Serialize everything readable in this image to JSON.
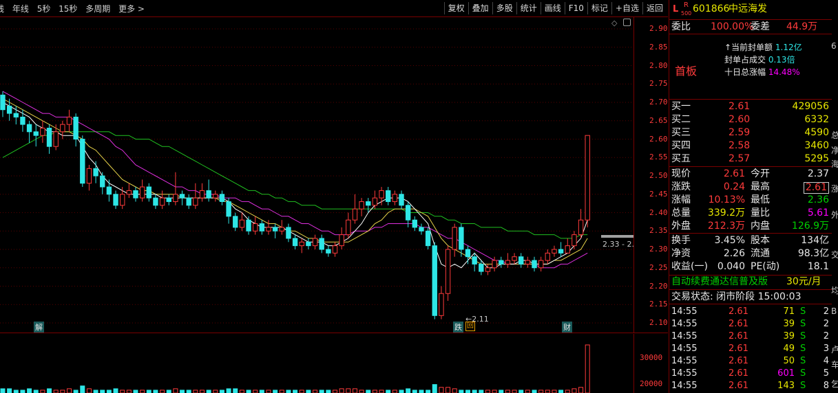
{
  "toolbar": {
    "left_items": [
      "线",
      "年线",
      "5秒",
      "15秒",
      "多周期",
      "更多 >"
    ],
    "right_items": [
      "复权",
      "叠加",
      "多股",
      "统计",
      "画线",
      "F10",
      "标记",
      "+自选",
      "返回"
    ]
  },
  "chart": {
    "price_ticks": [
      "2.90",
      "2.85",
      "2.80",
      "2.75",
      "2.70",
      "2.65",
      "2.60",
      "2.55",
      "2.50",
      "2.45",
      "2.40",
      "2.35",
      "2.30",
      "2.25",
      "2.20",
      "2.15",
      "2.10"
    ],
    "volume_ticks": [
      "30000",
      "20000"
    ],
    "annotations": {
      "low_price": "2.11",
      "last_price_marker": "2.33 - 2.",
      "event_jie": "解",
      "event_die": "跌",
      "event_hui": "回",
      "event_cai": "财"
    },
    "colors": {
      "up": "#ff3b3b",
      "down": "#2ee6e6",
      "ma5": "#ffffff",
      "ma10": "#e8d34a",
      "ma20": "#e030e0",
      "ma60": "#20c020"
    },
    "chart_data": {
      "type": "candlestick",
      "ylim": [
        2.08,
        2.92
      ],
      "candles": [
        [
          2.72,
          2.68,
          2.73,
          2.66
        ],
        [
          2.69,
          2.67,
          2.71,
          2.65
        ],
        [
          2.67,
          2.66,
          2.69,
          2.64
        ],
        [
          2.66,
          2.64,
          2.68,
          2.62
        ],
        [
          2.64,
          2.62,
          2.65,
          2.59
        ],
        [
          2.62,
          2.61,
          2.64,
          2.58
        ],
        [
          2.61,
          2.63,
          2.65,
          2.59
        ],
        [
          2.63,
          2.58,
          2.64,
          2.56
        ],
        [
          2.58,
          2.62,
          2.64,
          2.57
        ],
        [
          2.62,
          2.64,
          2.65,
          2.6
        ],
        [
          2.64,
          2.66,
          2.68,
          2.62
        ],
        [
          2.66,
          2.6,
          2.67,
          2.58
        ],
        [
          2.6,
          2.48,
          2.61,
          2.47
        ],
        [
          2.48,
          2.52,
          2.53,
          2.46
        ],
        [
          2.52,
          2.5,
          2.54,
          2.48
        ],
        [
          2.5,
          2.47,
          2.51,
          2.45
        ],
        [
          2.47,
          2.45,
          2.49,
          2.43
        ],
        [
          2.45,
          2.42,
          2.46,
          2.41
        ],
        [
          2.42,
          2.45,
          2.47,
          2.41
        ],
        [
          2.45,
          2.46,
          2.48,
          2.44
        ],
        [
          2.46,
          2.44,
          2.47,
          2.43
        ],
        [
          2.44,
          2.47,
          2.49,
          2.43
        ],
        [
          2.47,
          2.44,
          2.48,
          2.43
        ],
        [
          2.44,
          2.42,
          2.45,
          2.41
        ],
        [
          2.42,
          2.44,
          2.46,
          2.41
        ],
        [
          2.44,
          2.43,
          2.45,
          2.42
        ],
        [
          2.43,
          2.45,
          2.51,
          2.42
        ],
        [
          2.45,
          2.44,
          2.46,
          2.42
        ],
        [
          2.44,
          2.42,
          2.45,
          2.41
        ],
        [
          2.42,
          2.44,
          2.48,
          2.41
        ],
        [
          2.44,
          2.46,
          2.48,
          2.43
        ],
        [
          2.46,
          2.44,
          2.49,
          2.43
        ],
        [
          2.44,
          2.45,
          2.46,
          2.43
        ],
        [
          2.45,
          2.43,
          2.46,
          2.42
        ],
        [
          2.43,
          2.39,
          2.44,
          2.37
        ],
        [
          2.39,
          2.36,
          2.4,
          2.35
        ],
        [
          2.36,
          2.38,
          2.4,
          2.35
        ],
        [
          2.38,
          2.35,
          2.39,
          2.34
        ],
        [
          2.35,
          2.37,
          2.39,
          2.34
        ],
        [
          2.37,
          2.35,
          2.38,
          2.34
        ],
        [
          2.35,
          2.36,
          2.38,
          2.34
        ],
        [
          2.36,
          2.35,
          2.37,
          2.33
        ],
        [
          2.35,
          2.36,
          2.38,
          2.34
        ],
        [
          2.36,
          2.33,
          2.37,
          2.32
        ],
        [
          2.33,
          2.31,
          2.34,
          2.3
        ],
        [
          2.31,
          2.32,
          2.33,
          2.29
        ],
        [
          2.32,
          2.31,
          2.33,
          2.3
        ],
        [
          2.31,
          2.33,
          2.34,
          2.3
        ],
        [
          2.33,
          2.3,
          2.34,
          2.29
        ],
        [
          2.3,
          2.29,
          2.31,
          2.28
        ],
        [
          2.29,
          2.31,
          2.32,
          2.28
        ],
        [
          2.31,
          2.34,
          2.36,
          2.3
        ],
        [
          2.34,
          2.38,
          2.4,
          2.33
        ],
        [
          2.38,
          2.41,
          2.45,
          2.37
        ],
        [
          2.41,
          2.43,
          2.44,
          2.39
        ],
        [
          2.43,
          2.42,
          2.44,
          2.4
        ],
        [
          2.42,
          2.44,
          2.46,
          2.41
        ],
        [
          2.44,
          2.46,
          2.47,
          2.42
        ],
        [
          2.46,
          2.43,
          2.47,
          2.42
        ],
        [
          2.43,
          2.45,
          2.46,
          2.42
        ],
        [
          2.45,
          2.42,
          2.46,
          2.41
        ],
        [
          2.42,
          2.38,
          2.43,
          2.36
        ],
        [
          2.38,
          2.36,
          2.39,
          2.35
        ],
        [
          2.36,
          2.35,
          2.37,
          2.34
        ],
        [
          2.35,
          2.31,
          2.36,
          2.3
        ],
        [
          2.31,
          2.12,
          2.32,
          2.11
        ],
        [
          2.12,
          2.18,
          2.2,
          2.11
        ],
        [
          2.18,
          2.3,
          2.31,
          2.16
        ],
        [
          2.3,
          2.36,
          2.37,
          2.28
        ],
        [
          2.36,
          2.3,
          2.37,
          2.28
        ],
        [
          2.3,
          2.28,
          2.31,
          2.26
        ],
        [
          2.28,
          2.26,
          2.29,
          2.24
        ],
        [
          2.26,
          2.24,
          2.27,
          2.23
        ],
        [
          2.24,
          2.25,
          2.26,
          2.23
        ],
        [
          2.25,
          2.27,
          2.28,
          2.24
        ],
        [
          2.27,
          2.26,
          2.28,
          2.25
        ],
        [
          2.26,
          2.27,
          2.29,
          2.25
        ],
        [
          2.27,
          2.28,
          2.29,
          2.26
        ],
        [
          2.28,
          2.26,
          2.29,
          2.25
        ],
        [
          2.26,
          2.27,
          2.28,
          2.25
        ],
        [
          2.27,
          2.25,
          2.28,
          2.24
        ],
        [
          2.25,
          2.27,
          2.28,
          2.24
        ],
        [
          2.27,
          2.29,
          2.3,
          2.26
        ],
        [
          2.29,
          2.3,
          2.31,
          2.28
        ],
        [
          2.3,
          2.29,
          2.32,
          2.28
        ],
        [
          2.29,
          2.31,
          2.33,
          2.29
        ],
        [
          2.31,
          2.34,
          2.35,
          2.3
        ],
        [
          2.34,
          2.38,
          2.41,
          2.33
        ],
        [
          2.38,
          2.61,
          2.61,
          2.36
        ]
      ],
      "ma5": [
        2.7,
        2.69,
        2.68,
        2.67,
        2.66,
        2.64,
        2.63,
        2.62,
        2.62,
        2.61,
        2.61,
        2.61,
        2.58,
        2.55,
        2.53,
        2.5,
        2.48,
        2.47,
        2.46,
        2.45,
        2.45,
        2.45,
        2.45,
        2.45,
        2.44,
        2.44,
        2.44,
        2.44,
        2.44,
        2.44,
        2.44,
        2.44,
        2.44,
        2.44,
        2.43,
        2.41,
        2.4,
        2.38,
        2.37,
        2.36,
        2.36,
        2.36,
        2.36,
        2.35,
        2.34,
        2.33,
        2.32,
        2.32,
        2.32,
        2.31,
        2.31,
        2.32,
        2.33,
        2.35,
        2.37,
        2.4,
        2.42,
        2.43,
        2.44,
        2.44,
        2.44,
        2.43,
        2.41,
        2.39,
        2.37,
        2.31,
        2.26,
        2.25,
        2.26,
        2.25,
        2.27,
        2.29,
        2.27,
        2.25,
        2.25,
        2.26,
        2.26,
        2.26,
        2.27,
        2.27,
        2.26,
        2.26,
        2.26,
        2.27,
        2.28,
        2.29,
        2.31,
        2.33,
        2.38
      ],
      "ma10": [
        2.71,
        2.7,
        2.69,
        2.68,
        2.67,
        2.66,
        2.65,
        2.64,
        2.63,
        2.62,
        2.62,
        2.61,
        2.6,
        2.58,
        2.57,
        2.55,
        2.53,
        2.51,
        2.49,
        2.48,
        2.47,
        2.46,
        2.46,
        2.45,
        2.45,
        2.45,
        2.45,
        2.44,
        2.44,
        2.44,
        2.44,
        2.44,
        2.44,
        2.43,
        2.43,
        2.42,
        2.41,
        2.4,
        2.39,
        2.38,
        2.37,
        2.37,
        2.36,
        2.35,
        2.35,
        2.34,
        2.33,
        2.33,
        2.32,
        2.32,
        2.32,
        2.32,
        2.32,
        2.33,
        2.34,
        2.35,
        2.37,
        2.38,
        2.4,
        2.41,
        2.41,
        2.41,
        2.41,
        2.4,
        2.39,
        2.36,
        2.33,
        2.31,
        2.3,
        2.29,
        2.28,
        2.27,
        2.26,
        2.26,
        2.26,
        2.26,
        2.26,
        2.26,
        2.26,
        2.26,
        2.26,
        2.26,
        2.26,
        2.27,
        2.27,
        2.28,
        2.29,
        2.3,
        2.33
      ],
      "ma20": [
        2.73,
        2.72,
        2.71,
        2.7,
        2.69,
        2.68,
        2.67,
        2.67,
        2.66,
        2.66,
        2.66,
        2.65,
        2.64,
        2.63,
        2.62,
        2.61,
        2.6,
        2.58,
        2.57,
        2.55,
        2.53,
        2.52,
        2.51,
        2.5,
        2.49,
        2.48,
        2.47,
        2.47,
        2.46,
        2.46,
        2.45,
        2.45,
        2.45,
        2.44,
        2.44,
        2.44,
        2.43,
        2.43,
        2.42,
        2.41,
        2.41,
        2.4,
        2.39,
        2.39,
        2.38,
        2.37,
        2.37,
        2.36,
        2.35,
        2.35,
        2.34,
        2.34,
        2.34,
        2.35,
        2.35,
        2.35,
        2.36,
        2.36,
        2.37,
        2.37,
        2.37,
        2.37,
        2.37,
        2.36,
        2.36,
        2.35,
        2.34,
        2.33,
        2.33,
        2.32,
        2.31,
        2.3,
        2.29,
        2.28,
        2.27,
        2.27,
        2.26,
        2.26,
        2.26,
        2.26,
        2.26,
        2.25,
        2.25,
        2.25,
        2.26,
        2.26,
        2.27,
        2.28,
        2.29
      ],
      "ma60": [
        2.55,
        2.56,
        2.57,
        2.58,
        2.59,
        2.6,
        2.61,
        2.61,
        2.62,
        2.62,
        2.62,
        2.62,
        2.62,
        2.62,
        2.62,
        2.62,
        2.62,
        2.61,
        2.61,
        2.61,
        2.6,
        2.6,
        2.6,
        2.59,
        2.58,
        2.58,
        2.57,
        2.56,
        2.55,
        2.54,
        2.53,
        2.52,
        2.51,
        2.5,
        2.49,
        2.48,
        2.47,
        2.46,
        2.46,
        2.45,
        2.45,
        2.44,
        2.44,
        2.43,
        2.43,
        2.42,
        2.42,
        2.42,
        2.41,
        2.41,
        2.41,
        2.41,
        2.41,
        2.41,
        2.41,
        2.41,
        2.41,
        2.41,
        2.41,
        2.41,
        2.41,
        2.4,
        2.4,
        2.4,
        2.4,
        2.39,
        2.39,
        2.38,
        2.38,
        2.37,
        2.37,
        2.37,
        2.36,
        2.36,
        2.36,
        2.36,
        2.35,
        2.35,
        2.35,
        2.35,
        2.34,
        2.34,
        2.34,
        2.34,
        2.33,
        2.33,
        2.33,
        2.34,
        2.34
      ],
      "volumes": [
        3,
        3,
        2,
        2,
        3,
        2,
        2,
        3,
        2,
        2,
        3,
        2,
        5,
        3,
        2,
        2,
        2,
        3,
        2,
        2,
        2,
        2,
        2,
        2,
        2,
        2,
        3,
        2,
        2,
        2,
        2,
        2,
        2,
        2,
        3,
        3,
        2,
        2,
        2,
        2,
        2,
        2,
        2,
        2,
        2,
        2,
        2,
        2,
        2,
        2,
        2,
        3,
        3,
        3,
        2,
        2,
        2,
        2,
        2,
        2,
        2,
        3,
        2,
        2,
        2,
        6,
        4,
        4,
        3,
        2,
        2,
        2,
        2,
        2,
        2,
        2,
        2,
        2,
        2,
        2,
        2,
        2,
        2,
        2,
        2,
        2,
        3,
        4,
        34
      ]
    }
  },
  "panel": {
    "header": {
      "l_badge": "L",
      "r_badge": "R",
      "r_sub": "500",
      "code": "601866",
      "name": "中远海发"
    },
    "weibi_label": "委比",
    "weibi_value": "100.00%",
    "weicha_label": "委差",
    "weicha_value": "44.9万",
    "seal_rows": [
      {
        "label": "↑当前封单额",
        "value": "1.12亿"
      },
      {
        "label": "封单占成交",
        "value": "0.13倍"
      },
      {
        "label": "十日总涨幅",
        "value": "14.48%"
      }
    ],
    "first_board": "首板",
    "bids": [
      {
        "label": "买一",
        "price": "2.61",
        "vol": "429056"
      },
      {
        "label": "买二",
        "price": "2.60",
        "vol": "6332"
      },
      {
        "label": "买三",
        "price": "2.59",
        "vol": "4590"
      },
      {
        "label": "买四",
        "price": "2.58",
        "vol": "3460"
      },
      {
        "label": "买五",
        "price": "2.57",
        "vol": "5295"
      }
    ],
    "quote": [
      {
        "l1": "现价",
        "v1": "2.61",
        "l2": "今开",
        "v2": "2.37"
      },
      {
        "l1": "涨跌",
        "v1": "0.24",
        "l2": "最高",
        "v2": "2.61"
      },
      {
        "l1": "涨幅",
        "v1": "10.13%",
        "l2": "最低",
        "v2": "2.36"
      },
      {
        "l1": "总量",
        "v1": "339.2万",
        "l2": "量比",
        "v2": "5.61"
      },
      {
        "l1": "外盘",
        "v1": "212.3万",
        "l2": "内盘",
        "v2": "126.9万"
      }
    ],
    "fundamentals": [
      {
        "l1": "换手",
        "v1": "3.45%",
        "l2": "股本",
        "v2": "134亿"
      },
      {
        "l1": "净资",
        "v1": "2.26",
        "l2": "流通",
        "v2": "98.3亿"
      },
      {
        "l1": "收益(一)",
        "v1": "0.040",
        "l2": "PE(动)",
        "v2": "18.1"
      }
    ],
    "ad_text": "自动续费通达信普及版",
    "ad_price": "30元/月",
    "trade_status": "交易状态: 闭市阶段 15:00:03",
    "ticks": [
      {
        "time": "14:55",
        "price": "2.61",
        "vol": "71",
        "side": "S",
        "n": "2"
      },
      {
        "time": "14:55",
        "price": "2.61",
        "vol": "39",
        "side": "S",
        "n": "2"
      },
      {
        "time": "14:55",
        "price": "2.61",
        "vol": "39",
        "side": "S",
        "n": "2"
      },
      {
        "time": "14:55",
        "price": "2.61",
        "vol": "49",
        "side": "S",
        "n": "3"
      },
      {
        "time": "14:55",
        "price": "2.61",
        "vol": "50",
        "side": "S",
        "n": "4"
      },
      {
        "time": "14:55",
        "price": "2.61",
        "vol": "601",
        "side": "S",
        "n": "5"
      },
      {
        "time": "14:55",
        "price": "2.61",
        "vol": "143",
        "side": "S",
        "n": "8"
      }
    ]
  },
  "edge_strip": [
    "6",
    "总",
    "净",
    "海",
    "涨",
    "外",
    "交",
    "均",
    "B",
    "卢",
    "车",
    "乞"
  ]
}
